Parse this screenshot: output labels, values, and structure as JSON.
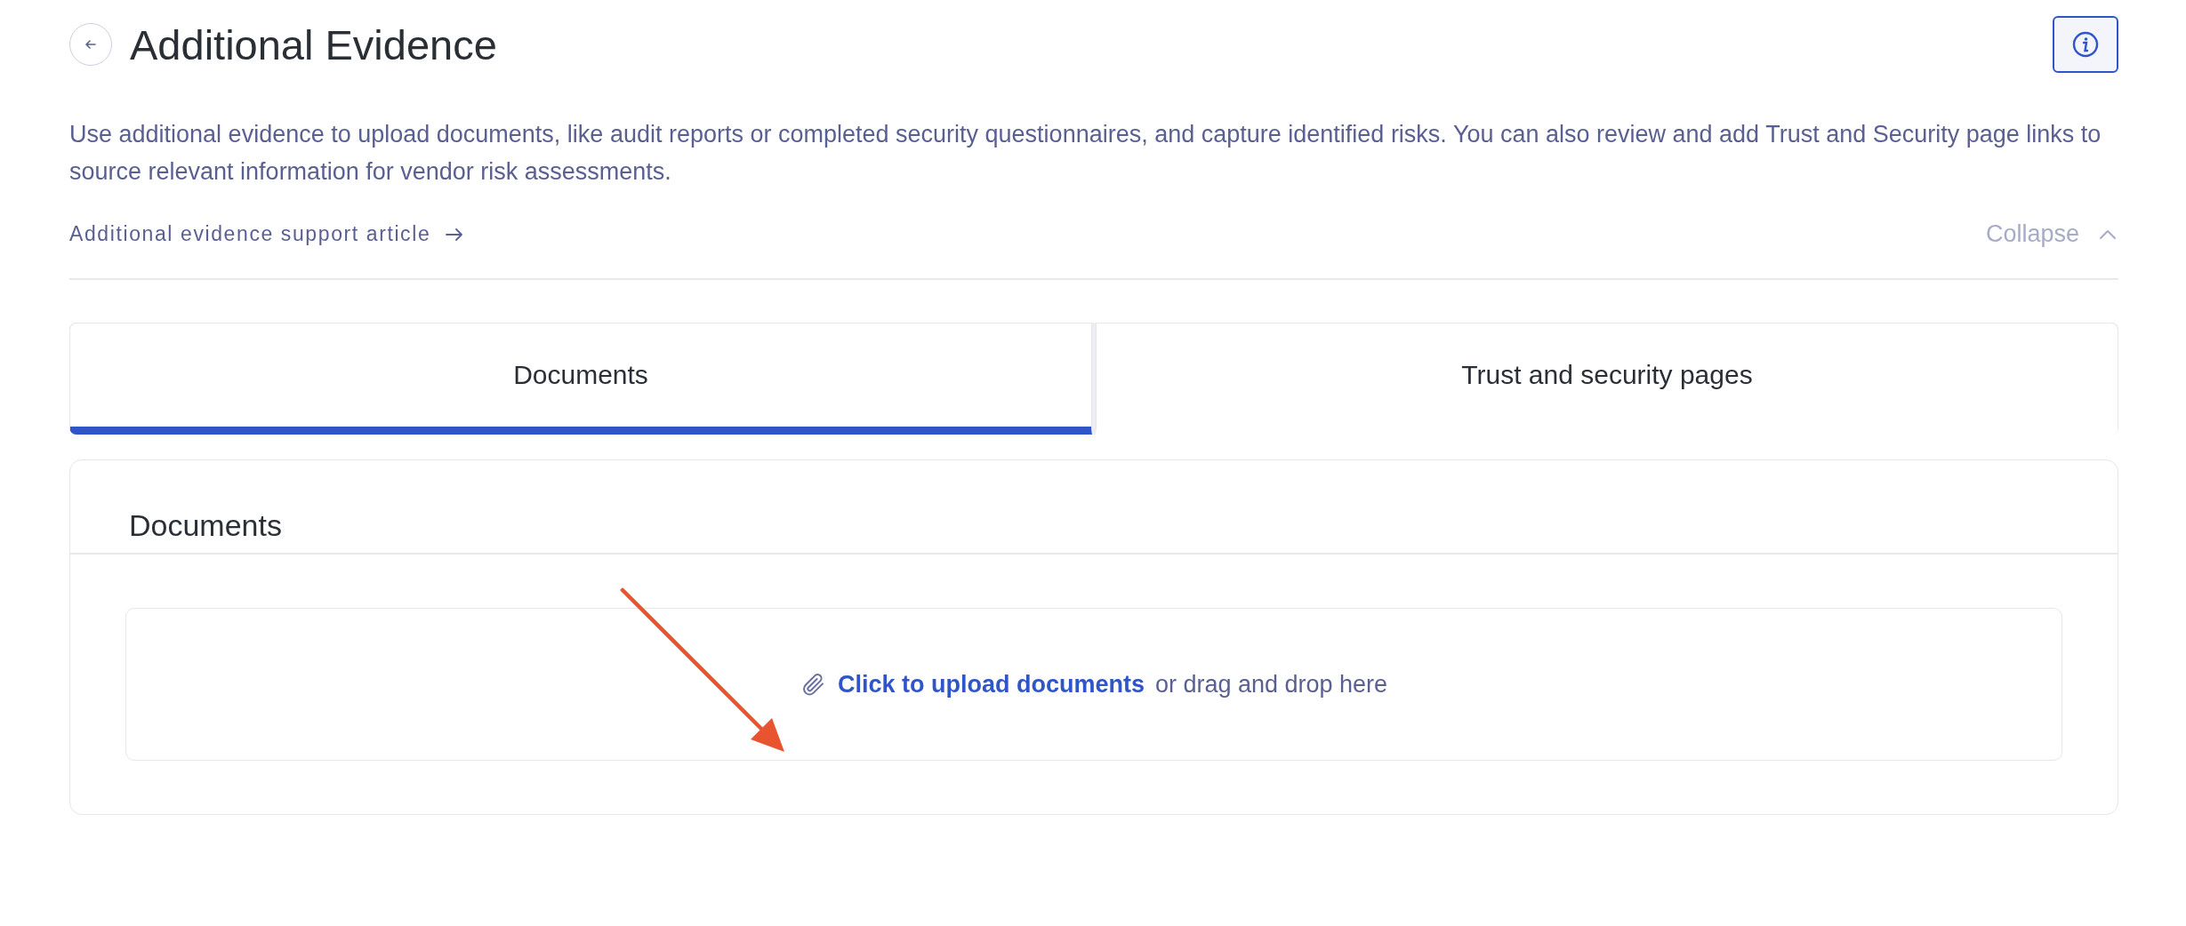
{
  "header": {
    "title": "Additional Evidence",
    "description": "Use additional evidence to upload documents, like audit reports or completed security questionnaires, and capture identified risks. You can also review and add Trust and Security page links to source relevant information for vendor risk assessments.",
    "support_link": "Additional evidence support article",
    "collapse": "Collapse"
  },
  "tabs": [
    {
      "label": "Documents",
      "selected": true
    },
    {
      "label": "Trust and security pages",
      "selected": false
    }
  ],
  "documents": {
    "heading": "Documents",
    "upload_link": "Click to upload documents",
    "upload_hint": "or drag and drop here"
  }
}
